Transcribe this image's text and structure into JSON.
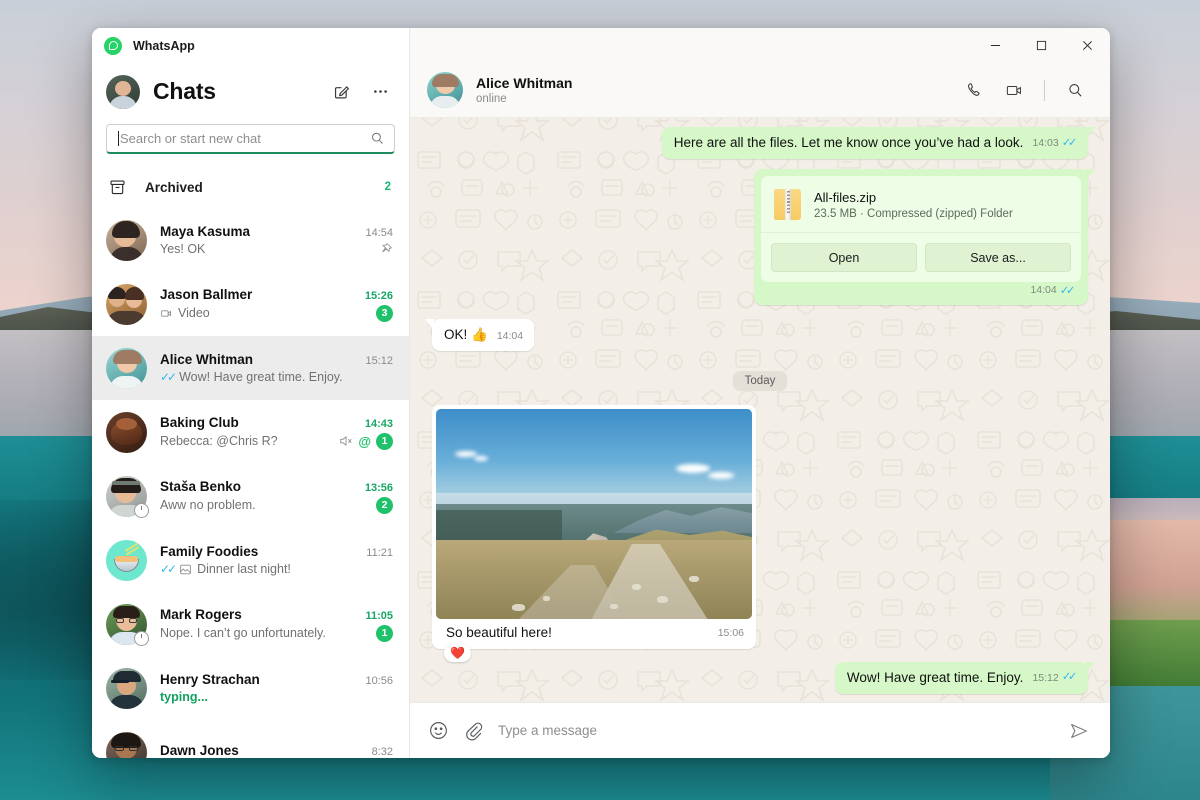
{
  "app": {
    "brand": "WhatsApp",
    "accent_green": "#1fc16b",
    "bubble_out_color": "#d6f8c8",
    "tick_blue": "#34b7f1"
  },
  "window_controls": {
    "minimize": "minimize-icon",
    "maximize": "maximize-icon",
    "close": "close-icon"
  },
  "sidebar": {
    "title": "Chats",
    "compose_icon": "compose-icon",
    "menu_icon": "more-options-icon",
    "search": {
      "value": "",
      "placeholder": "Search or start new chat"
    },
    "archived": {
      "label": "Archived",
      "count": "2"
    },
    "chats": [
      {
        "name": "Maya Kasuma",
        "time": "14:54",
        "message": "Yes! OK",
        "unread": false,
        "badge": "",
        "pinned": true,
        "ticks": false,
        "avatar": "photo-woman-dark-hair"
      },
      {
        "name": "Jason Ballmer",
        "time": "15:26",
        "message": "Video",
        "unread": true,
        "badge": "3",
        "pinned": false,
        "ticks": false,
        "video_icon": true,
        "avatar": "photo-couple"
      },
      {
        "name": "Alice Whitman",
        "time": "15:12",
        "message": "Wow! Have great time. Enjoy.",
        "unread": false,
        "badge": "",
        "pinned": false,
        "ticks": true,
        "active": true,
        "avatar": "photo-woman-teal"
      },
      {
        "name": "Baking Club",
        "time": "14:43",
        "message": "Rebecca: @Chris R?",
        "unread": true,
        "badge": "1",
        "muted": true,
        "mention": "@",
        "ticks": false,
        "avatar": "photo-cake"
      },
      {
        "name": "Staša Benko",
        "time": "13:56",
        "message": "Aww no problem.",
        "unread": true,
        "badge": "2",
        "status_ring": true,
        "ticks": false,
        "avatar": "photo-woman-headband"
      },
      {
        "name": "Family Foodies",
        "time": "11:21",
        "message": "Dinner last night!",
        "unread": false,
        "badge": "",
        "ticks": true,
        "image_icon": true,
        "avatar": "emoji-noodle-bowl"
      },
      {
        "name": "Mark Rogers",
        "time": "11:05",
        "message": "Nope. I can’t go unfortunately.",
        "unread": true,
        "badge": "1",
        "status_ring": true,
        "ticks": false,
        "avatar": "photo-man-glasses"
      },
      {
        "name": "Henry Strachan",
        "time": "10:56",
        "message": "typing...",
        "unread": false,
        "badge": "",
        "typing": true,
        "ticks": false,
        "avatar": "photo-man-cap"
      },
      {
        "name": "Dawn Jones",
        "time": "8:32",
        "message": "",
        "unread": false,
        "badge": "",
        "ticks": false,
        "avatar": "photo-woman-glasses"
      }
    ]
  },
  "chat_header": {
    "name": "Alice Whitman",
    "status": "online",
    "call_icon": "phone-icon",
    "video_icon": "video-camera-icon",
    "search_icon": "search-icon"
  },
  "conversation": {
    "date_divider": "Today",
    "messages": [
      {
        "id": "m1",
        "dir": "out",
        "type": "text",
        "text": "Here are all the files. Let me know once you’ve had a look.",
        "time": "14:03",
        "ticks": true
      },
      {
        "id": "m2",
        "dir": "out",
        "type": "file",
        "file_name": "All-files.zip",
        "file_meta": "23.5 MB · Compressed (zipped) Folder",
        "open_label": "Open",
        "save_label": "Save as...",
        "time": "14:04",
        "ticks": true
      },
      {
        "id": "m3",
        "dir": "in",
        "type": "text",
        "text": "OK! 👍",
        "time": "14:04",
        "ticks": false
      },
      {
        "id": "m4",
        "dir": "in",
        "type": "image",
        "caption": "So beautiful here!",
        "time": "15:06",
        "reaction": "❤️",
        "ticks": false,
        "photo_alt": "mountain-ridge-landscape"
      },
      {
        "id": "m5",
        "dir": "out",
        "type": "text",
        "text": "Wow! Have great time. Enjoy.",
        "time": "15:12",
        "ticks": true
      }
    ]
  },
  "composer": {
    "emoji_icon": "emoji-icon",
    "attach_icon": "attachment-clip-icon",
    "input": {
      "value": "",
      "placeholder": "Type a message"
    },
    "send_icon": "send-icon"
  }
}
